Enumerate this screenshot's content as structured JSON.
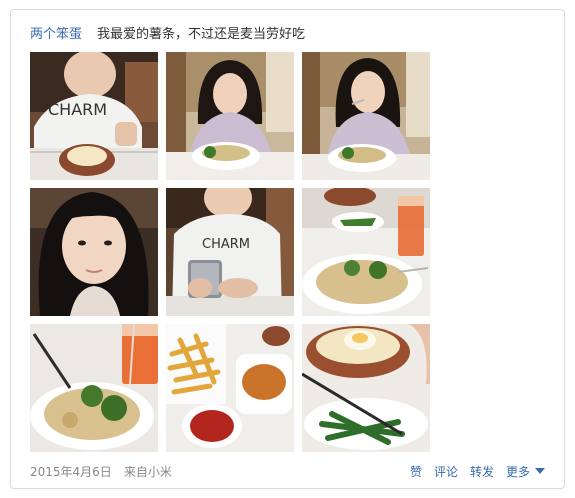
{
  "post": {
    "author": "两个笨蛋",
    "text": "我最爱的薯条，不过还是麦当劳好吃",
    "photos": [
      {
        "name": "photo-boy-charm-shirt",
        "shirt_text": "CHARM"
      },
      {
        "name": "photo-girl-eating-1"
      },
      {
        "name": "photo-girl-eating-2"
      },
      {
        "name": "photo-girl-selfie"
      },
      {
        "name": "photo-boy-with-phone",
        "shirt_text": "CHARM"
      },
      {
        "name": "photo-pasta-and-juice"
      },
      {
        "name": "photo-pasta-broccoli"
      },
      {
        "name": "photo-fries-and-sauce"
      },
      {
        "name": "photo-rice-bowl-greens"
      }
    ],
    "date": "2015年4月6日",
    "source": "来自小米"
  },
  "actions": {
    "like": "赞",
    "comment": "评论",
    "repost": "转发",
    "more": "更多"
  },
  "colors": {
    "link": "#3a6bb0",
    "muted": "#888888",
    "text": "#333333"
  }
}
